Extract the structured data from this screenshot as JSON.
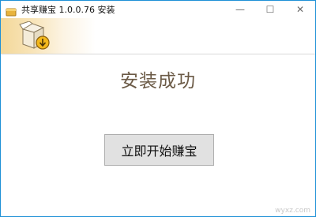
{
  "window": {
    "title": "共享赚宝 1.0.0.76 安装",
    "controls": {
      "minimize": "—",
      "maximize": "☐",
      "close": "✕"
    }
  },
  "banner": {
    "icon": "installer-box-icon"
  },
  "main": {
    "message": "安装成功",
    "button_label": "立即开始赚宝"
  },
  "watermark": {
    "text": "wyxz.com"
  },
  "colors": {
    "frame_border": "#1e90d6",
    "message_text": "#6b5a46",
    "button_bg": "#e1e1e1",
    "banner_gradient_start": "#f3d89a"
  }
}
